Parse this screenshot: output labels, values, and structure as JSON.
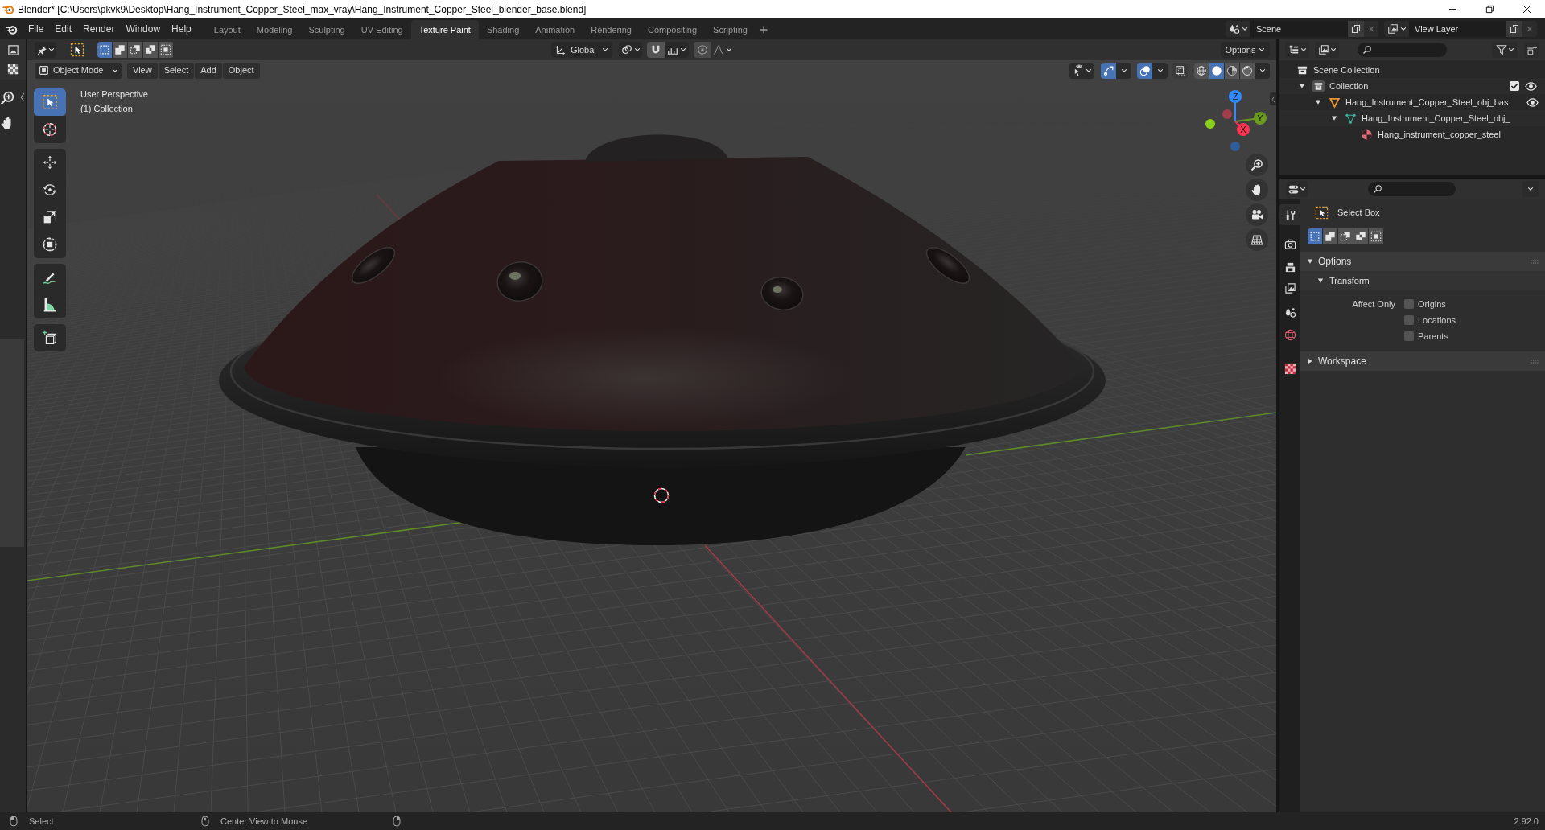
{
  "window": {
    "title": "Blender* [C:\\Users\\pkvk9\\Desktop\\Hang_Instrument_Copper_Steel_max_vray\\Hang_Instrument_Copper_Steel_blender_base.blend]"
  },
  "menus": [
    "File",
    "Edit",
    "Render",
    "Window",
    "Help"
  ],
  "workspace_tabs": [
    {
      "label": "Layout",
      "selected": false
    },
    {
      "label": "Modeling",
      "selected": false
    },
    {
      "label": "Sculpting",
      "selected": false
    },
    {
      "label": "UV Editing",
      "selected": false
    },
    {
      "label": "Texture Paint",
      "selected": true
    },
    {
      "label": "Shading",
      "selected": false
    },
    {
      "label": "Animation",
      "selected": false
    },
    {
      "label": "Rendering",
      "selected": false
    },
    {
      "label": "Compositing",
      "selected": false
    },
    {
      "label": "Scripting",
      "selected": false
    }
  ],
  "scene": {
    "name": "Scene"
  },
  "view_layer": {
    "name": "View Layer"
  },
  "viewport": {
    "tool_settings": {
      "select_modes": [
        {
          "kind": "set",
          "selected": true
        },
        {
          "kind": "extend",
          "selected": false
        },
        {
          "kind": "subtract",
          "selected": false
        },
        {
          "kind": "difference",
          "selected": false
        },
        {
          "kind": "intersect",
          "selected": false
        }
      ],
      "orientation": "Global",
      "snap": false,
      "proportional_editing": false,
      "options": "Options"
    },
    "header": {
      "mode": "Object Mode",
      "menus": [
        "View",
        "Select",
        "Add",
        "Object"
      ],
      "gizmos": true,
      "overlays": true,
      "xray": false,
      "shading": [
        {
          "kind": "wireframe",
          "selected": false
        },
        {
          "kind": "solid",
          "selected": true
        },
        {
          "kind": "material",
          "selected": false
        },
        {
          "kind": "rendered",
          "selected": false
        }
      ]
    },
    "info": [
      "User Perspective",
      "(1) Collection"
    ],
    "toolbar": [
      [
        {
          "kind": "select_box",
          "selected": true
        },
        {
          "kind": "cursor",
          "selected": false
        }
      ],
      [
        {
          "kind": "move",
          "selected": false
        },
        {
          "kind": "rotate",
          "selected": false
        },
        {
          "kind": "scale",
          "selected": false
        },
        {
          "kind": "transform",
          "selected": false
        }
      ],
      [
        {
          "kind": "annotate",
          "selected": false
        },
        {
          "kind": "measure",
          "selected": false
        }
      ],
      [
        {
          "kind": "add_cube",
          "selected": false
        }
      ]
    ],
    "axis_handles": [
      {
        "label": "Z",
        "color": "#2f8bff"
      },
      {
        "label": "Y",
        "color": "#6a9a1f"
      },
      {
        "label": "X",
        "color": "#ff3352"
      }
    ],
    "negative_axis_handles": [
      {
        "color": "#a23d4c"
      },
      {
        "color": "#8bd11c"
      },
      {
        "color": "#305d9c"
      }
    ]
  },
  "outliner": {
    "tree": [
      {
        "label": "Scene Collection",
        "kind": "scene_collection",
        "children": [
          {
            "label": "Collection",
            "kind": "collection",
            "expanded": true,
            "checked": true,
            "visible": true,
            "children": [
              {
                "label": "Hang_Instrument_Copper_Steel_obj_bas",
                "kind": "object",
                "expanded": true,
                "visible": true,
                "children": [
                  {
                    "label": "Hang_Instrument_Copper_Steel_obj_",
                    "kind": "mesh",
                    "expanded": true,
                    "children": [
                      {
                        "label": "Hang_instrument_copper_steel",
                        "kind": "material"
                      }
                    ]
                  }
                ]
              }
            ]
          }
        ]
      }
    ]
  },
  "properties": {
    "tabs": [
      {
        "kind": "tool",
        "selected": true
      },
      {
        "kind": "render",
        "selected": false
      },
      {
        "kind": "output",
        "selected": false
      },
      {
        "kind": "view_layer",
        "selected": false
      },
      {
        "kind": "scene",
        "selected": false
      },
      {
        "kind": "world",
        "selected": false
      },
      {
        "kind": "texture",
        "selected": false
      }
    ],
    "tool": {
      "name": "Select Box",
      "modes": [
        {
          "kind": "set",
          "selected": true
        },
        {
          "kind": "extend",
          "selected": false
        },
        {
          "kind": "subtract",
          "selected": false
        },
        {
          "kind": "difference",
          "selected": false
        },
        {
          "kind": "intersect",
          "selected": false
        }
      ]
    },
    "panels": [
      {
        "title": "Options",
        "expanded": true,
        "subpanels": [
          {
            "title": "Transform",
            "expanded": true,
            "label": "Affect Only",
            "checkboxes": [
              {
                "label": "Origins",
                "checked": false
              },
              {
                "label": "Locations",
                "checked": false
              },
              {
                "label": "Parents",
                "checked": false
              }
            ]
          }
        ]
      },
      {
        "title": "Workspace",
        "expanded": false
      }
    ]
  },
  "status_bar": {
    "hints": [
      {
        "kind": "left_mouse",
        "label": "Select"
      },
      {
        "kind": "middle_mouse",
        "label": "Center View to Mouse"
      },
      {
        "kind": "right_mouse"
      }
    ],
    "version": "2.92.0"
  }
}
